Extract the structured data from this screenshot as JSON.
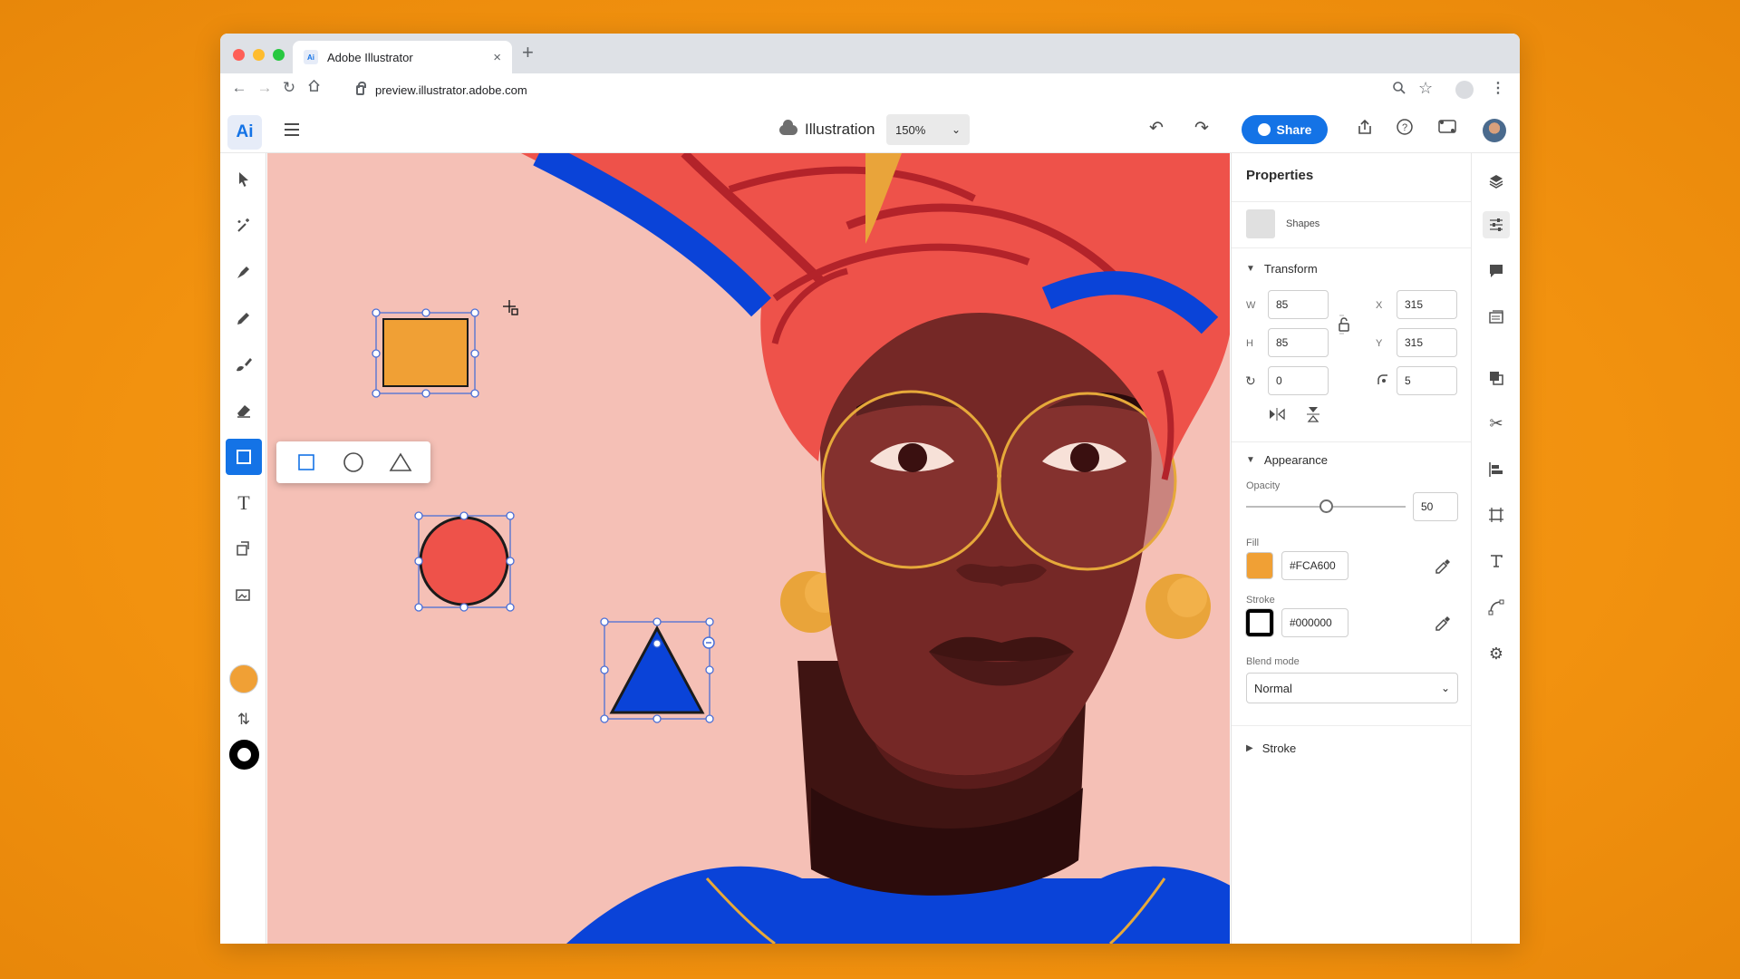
{
  "browser": {
    "tab_title": "Adobe Illustrator",
    "favicon_text": "Ai",
    "new_tab": "+",
    "tab_close": "×",
    "url": "preview.illustrator.adobe.com"
  },
  "app": {
    "logo": "Ai",
    "document_name": "Illustration",
    "zoom": "150%",
    "share_label": "Share"
  },
  "toolbar": {
    "tools": [
      "selection",
      "direct-selection",
      "pen",
      "pencil",
      "paintbrush",
      "eraser",
      "rectangle",
      "type",
      "shape-builder",
      "image-place"
    ],
    "active_tool": "rectangle",
    "fill_color": "#F0A035",
    "stroke_color": "#000000",
    "shape_flyout": [
      "rectangle",
      "ellipse",
      "polygon"
    ]
  },
  "properties": {
    "title": "Properties",
    "selection_label": "Shapes",
    "transform": {
      "label": "Transform",
      "w_label": "W",
      "w": "85",
      "h_label": "H",
      "h": "85",
      "x_label": "X",
      "x": "315",
      "y_label": "Y",
      "y": "315",
      "rotation": "0",
      "corner_radius": "5"
    },
    "appearance": {
      "label": "Appearance",
      "opacity_label": "Opacity",
      "opacity": "50",
      "opacity_fraction": 0.5,
      "fill_label": "Fill",
      "fill_hex": "#FCA600",
      "stroke_label": "Stroke",
      "stroke_hex": "#000000",
      "blend_label": "Blend mode",
      "blend_mode": "Normal"
    },
    "stroke_section": "Stroke"
  },
  "colors": {
    "accent": "#1473e6",
    "canvas_bg": "#f5c0b6",
    "fill_swatch": "#F0A035"
  }
}
